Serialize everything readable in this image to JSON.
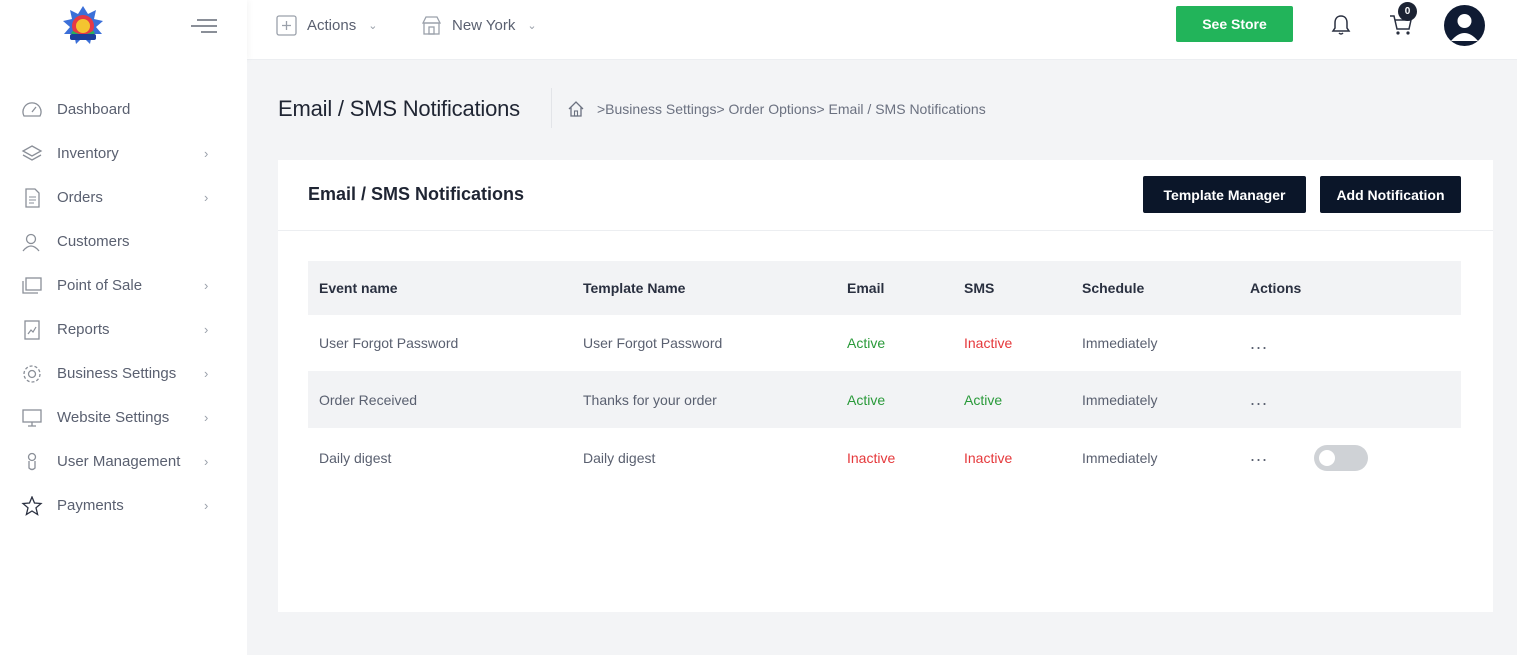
{
  "topbar": {
    "actions_label": "Actions",
    "location_label": "New York",
    "see_store_label": "See Store",
    "cart_count": "0"
  },
  "sidebar": {
    "items": [
      {
        "label": "Dashboard",
        "icon": "dashboard-icon",
        "has_submenu": false
      },
      {
        "label": "Inventory",
        "icon": "layers-icon",
        "has_submenu": true
      },
      {
        "label": "Orders",
        "icon": "document-icon",
        "has_submenu": true
      },
      {
        "label": "Customers",
        "icon": "users-icon",
        "has_submenu": false
      },
      {
        "label": "Point of Sale",
        "icon": "pos-icon",
        "has_submenu": true
      },
      {
        "label": "Reports",
        "icon": "report-icon",
        "has_submenu": true
      },
      {
        "label": "Business Settings",
        "icon": "gear-icon",
        "has_submenu": true
      },
      {
        "label": "Website Settings",
        "icon": "monitor-icon",
        "has_submenu": true
      },
      {
        "label": "User Management",
        "icon": "user-icon",
        "has_submenu": true
      },
      {
        "label": "Payments",
        "icon": "star-icon",
        "has_submenu": true
      }
    ]
  },
  "page": {
    "title": "Email / SMS Notifications",
    "breadcrumb": [
      ">Business Settings",
      "> Order Options",
      "> Email / SMS Notifications"
    ]
  },
  "card": {
    "title": "Email / SMS Notifications",
    "template_manager_label": "Template Manager",
    "add_notification_label": "Add Notification"
  },
  "table": {
    "headers": [
      "Event name",
      "Template Name",
      "Email",
      "SMS",
      "Schedule",
      "Actions"
    ],
    "rows": [
      {
        "event": "User Forgot Password",
        "template": "User Forgot Password",
        "email": "Active",
        "sms": "Inactive",
        "schedule": "Immediately",
        "actions": "..."
      },
      {
        "event": "Order Received",
        "template": "Thanks for your order",
        "email": "Active",
        "sms": "Active",
        "schedule": "Immediately",
        "actions": "..."
      },
      {
        "event": "Daily digest",
        "template": "Daily digest",
        "email": "Inactive",
        "sms": "Inactive",
        "schedule": "Immediately",
        "actions": "...",
        "toggle_on": false
      }
    ]
  },
  "colors": {
    "accent_green": "#22b45a",
    "dark_button": "#0b1629",
    "active_text": "#2a9a3a",
    "inactive_text": "#e5383b"
  }
}
